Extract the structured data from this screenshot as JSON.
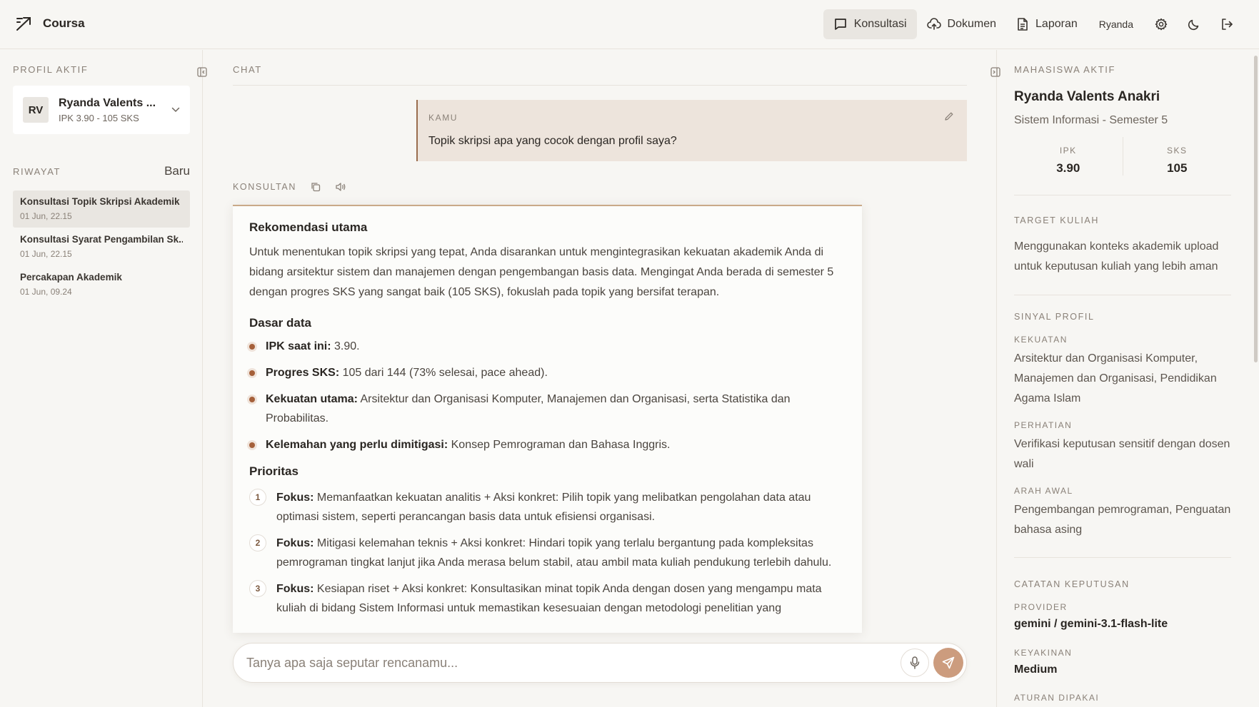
{
  "app": {
    "name": "Coursa"
  },
  "nav": {
    "konsultasi": "Konsultasi",
    "dokumen": "Dokumen",
    "laporan": "Laporan",
    "user": "Ryanda"
  },
  "sidebar": {
    "profile_label": "PROFIL AKTIF",
    "profile": {
      "initials": "RV",
      "name": "Ryanda Valents ...",
      "sub": "IPK 3.90 - 105 SKS"
    },
    "history_label": "RIWAYAT",
    "new_label": "Baru",
    "history": [
      {
        "title": "Konsultasi Topik Skripsi Akademik",
        "date": "01 Jun, 22.15"
      },
      {
        "title": "Konsultasi Syarat Pengambilan Sk...",
        "date": "01 Jun, 22.15"
      },
      {
        "title": "Percakapan Akademik",
        "date": "01 Jun, 09.24"
      }
    ]
  },
  "chat": {
    "label": "CHAT",
    "user_label": "KAMU",
    "user_message": "Topik skripsi apa yang cocok dengan profil saya?",
    "consultant_label": "KONSULTAN",
    "answer": {
      "h1": "Rekomendasi utama",
      "p1": "Untuk menentukan topik skripsi yang tepat, Anda disarankan untuk mengintegrasikan kekuatan akademik Anda di bidang arsitektur sistem dan manajemen dengan pengembangan basis data. Mengingat Anda berada di semester 5 dengan progres SKS yang sangat baik (105 SKS), fokuslah pada topik yang bersifat terapan.",
      "h2": "Dasar data",
      "bullets": [
        {
          "k": "IPK saat ini:",
          "v": " 3.90."
        },
        {
          "k": "Progres SKS:",
          "v": " 105 dari 144 (73% selesai, pace ahead)."
        },
        {
          "k": "Kekuatan utama:",
          "v": " Arsitektur dan Organisasi Komputer, Manajemen dan Organisasi, serta Statistika dan Probabilitas."
        },
        {
          "k": "Kelemahan yang perlu dimitigasi:",
          "v": " Konsep Pemrograman dan Bahasa Inggris."
        }
      ],
      "h3": "Prioritas",
      "priorities": [
        {
          "n": "1",
          "k": "Fokus:",
          "v": " Memanfaatkan kekuatan analitis + Aksi konkret: Pilih topik yang melibatkan pengolahan data atau optimasi sistem, seperti perancangan basis data untuk efisiensi organisasi."
        },
        {
          "n": "2",
          "k": "Fokus:",
          "v": " Mitigasi kelemahan teknis + Aksi konkret: Hindari topik yang terlalu bergantung pada kompleksitas pemrograman tingkat lanjut jika Anda merasa belum stabil, atau ambil mata kuliah pendukung terlebih dahulu."
        },
        {
          "n": "3",
          "k": "Fokus:",
          "v": " Kesiapan riset + Aksi konkret: Konsultasikan minat topik Anda dengan dosen yang mengampu mata kuliah di bidang Sistem Informasi untuk memastikan kesesuaian dengan metodologi penelitian yang"
        }
      ]
    },
    "input_placeholder": "Tanya apa saja seputar rencanamu..."
  },
  "right": {
    "label": "MAHASISWA AKTIF",
    "name": "Ryanda Valents Anakri",
    "program": "Sistem Informasi - Semester 5",
    "ipk_label": "IPK",
    "ipk": "3.90",
    "sks_label": "SKS",
    "sks": "105",
    "target_label": "TARGET KULIAH",
    "target_text": "Menggunakan konteks akademik upload untuk keputusan kuliah yang lebih aman",
    "signal_label": "SINYAL PROFIL",
    "strength_label": "KEKUATAN",
    "strength_text": "Arsitektur dan Organisasi Komputer, Manajemen dan Organisasi, Pendidikan Agama Islam",
    "attention_label": "PERHATIAN",
    "attention_text": "Verifikasi keputusan sensitif dengan dosen wali",
    "direction_label": "ARAH AWAL",
    "direction_text": "Pengembangan pemrograman, Penguatan bahasa asing",
    "notes_label": "CATATAN KEPUTUSAN",
    "provider_label": "PROVIDER",
    "provider": "gemini / gemini-3.1-flash-lite",
    "confidence_label": "KEYAKINAN",
    "confidence": "Medium",
    "rules_label": "ATURAN DIPAKAI"
  },
  "colors": {
    "accent": "#cc9c7e",
    "bullet": "#a5603a",
    "user_bubble": "#ede4dc"
  },
  "icons": [
    "logo-icon",
    "chat-icon",
    "upload-cloud-icon",
    "document-icon",
    "gear-icon",
    "moon-icon",
    "logout-icon",
    "collapse-icon",
    "chevron-down-icon",
    "pencil-icon",
    "copy-icon",
    "speaker-icon",
    "mic-icon",
    "send-icon"
  ]
}
